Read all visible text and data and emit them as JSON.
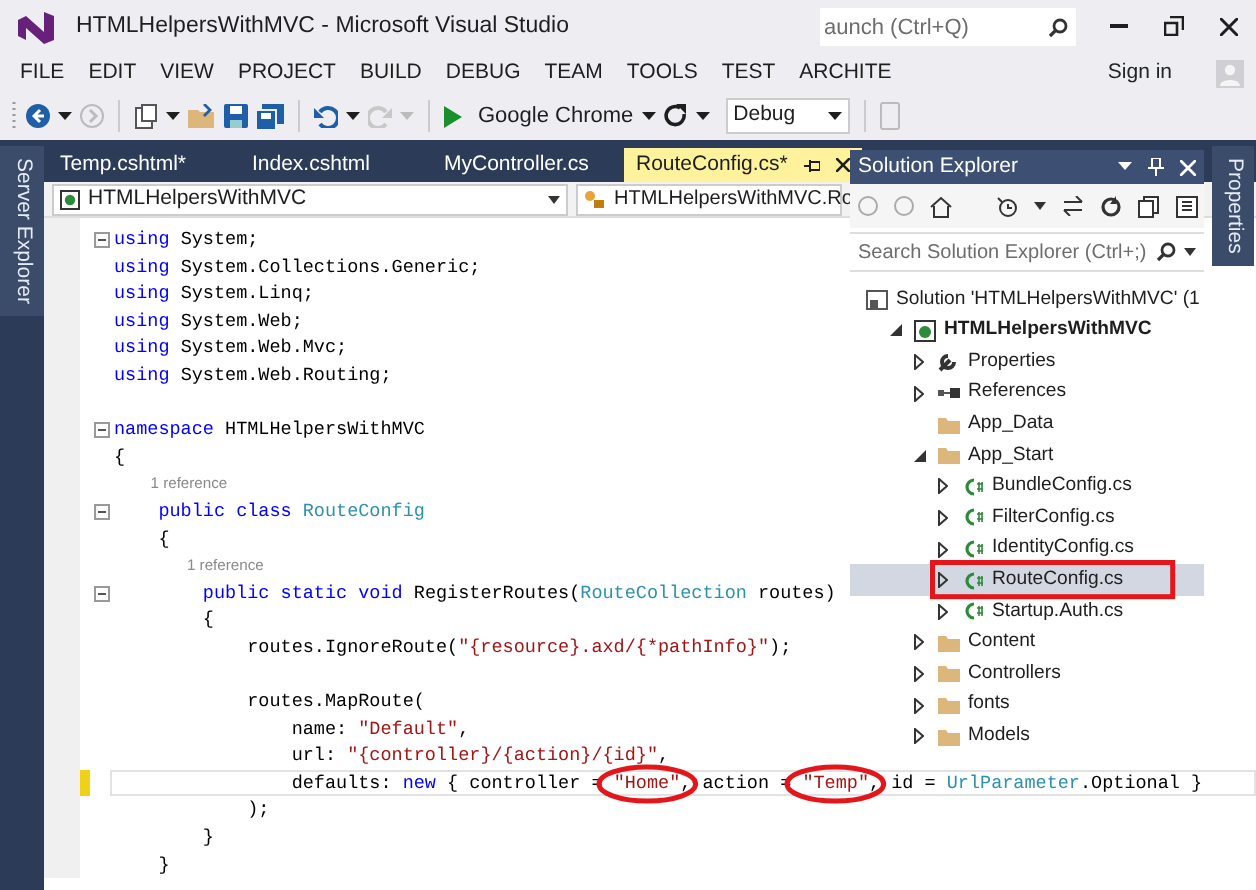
{
  "window": {
    "title": "HTMLHelpersWithMVC - Microsoft Visual Studio"
  },
  "quick_launch": {
    "placeholder": "aunch (Ctrl+Q)"
  },
  "menu": [
    "FILE",
    "EDIT",
    "VIEW",
    "PROJECT",
    "BUILD",
    "DEBUG",
    "TEAM",
    "TOOLS",
    "TEST",
    "ARCHITE"
  ],
  "account": {
    "label": "Sign in"
  },
  "toolbar": {
    "run_target": "Google Chrome",
    "configuration": "Debug"
  },
  "side_tabs": {
    "left": "Server Explorer",
    "right": "Properties"
  },
  "editor_tabs": [
    {
      "label": "Temp.cshtml*",
      "selected": false
    },
    {
      "label": "Index.cshtml",
      "selected": false
    },
    {
      "label": "MyController.cs",
      "selected": false
    },
    {
      "label": "RouteConfig.cs*",
      "selected": true
    }
  ],
  "nav_bar": {
    "project": "HTMLHelpersWithMVC",
    "type": "HTMLHelpersWithMVC.Ro"
  },
  "code_lines": [
    {
      "kind": "code",
      "fold": true,
      "modified": false,
      "current": false,
      "tokens": [
        {
          "kind": "kw",
          "text": "using"
        },
        {
          "kind": "plain",
          "text": " System;"
        }
      ]
    },
    {
      "kind": "code",
      "fold": false,
      "modified": false,
      "current": false,
      "tokens": [
        {
          "kind": "kw",
          "text": "using"
        },
        {
          "kind": "plain",
          "text": " System.Collections.Generic;"
        }
      ]
    },
    {
      "kind": "code",
      "fold": false,
      "modified": false,
      "current": false,
      "tokens": [
        {
          "kind": "kw",
          "text": "using"
        },
        {
          "kind": "plain",
          "text": " System.Linq;"
        }
      ]
    },
    {
      "kind": "code",
      "fold": false,
      "modified": false,
      "current": false,
      "tokens": [
        {
          "kind": "kw",
          "text": "using"
        },
        {
          "kind": "plain",
          "text": " System.Web;"
        }
      ]
    },
    {
      "kind": "code",
      "fold": false,
      "modified": false,
      "current": false,
      "tokens": [
        {
          "kind": "kw",
          "text": "using"
        },
        {
          "kind": "plain",
          "text": " System.Web.Mvc;"
        }
      ]
    },
    {
      "kind": "code",
      "fold": false,
      "modified": false,
      "current": false,
      "tokens": [
        {
          "kind": "kw",
          "text": "using"
        },
        {
          "kind": "plain",
          "text": " System.Web.Routing;"
        }
      ]
    },
    {
      "kind": "blank"
    },
    {
      "kind": "code",
      "fold": true,
      "modified": false,
      "current": false,
      "tokens": [
        {
          "kind": "kw",
          "text": "namespace"
        },
        {
          "kind": "plain",
          "text": " HTMLHelpersWithMVC"
        }
      ]
    },
    {
      "kind": "code",
      "fold": false,
      "modified": false,
      "current": false,
      "tokens": [
        {
          "kind": "plain",
          "text": "{"
        }
      ]
    },
    {
      "kind": "lens",
      "text": "1 reference"
    },
    {
      "kind": "code",
      "fold": true,
      "modified": false,
      "current": false,
      "tokens": [
        {
          "kind": "kw",
          "text": "    public "
        },
        {
          "kind": "kw",
          "text": "class "
        },
        {
          "kind": "type",
          "text": "RouteConfig"
        }
      ]
    },
    {
      "kind": "code",
      "fold": false,
      "modified": false,
      "current": false,
      "tokens": [
        {
          "kind": "plain",
          "text": "    {"
        }
      ]
    },
    {
      "kind": "lens",
      "text": "1 reference"
    },
    {
      "kind": "code",
      "fold": true,
      "modified": false,
      "current": false,
      "tokens": [
        {
          "kind": "kw",
          "text": "        public "
        },
        {
          "kind": "kw",
          "text": "static "
        },
        {
          "kind": "kw",
          "text": "void "
        },
        {
          "kind": "plain",
          "text": "RegisterRoutes("
        },
        {
          "kind": "type",
          "text": "RouteCollection"
        },
        {
          "kind": "plain",
          "text": " routes)"
        }
      ]
    },
    {
      "kind": "code",
      "fold": false,
      "modified": false,
      "current": false,
      "tokens": [
        {
          "kind": "plain",
          "text": "        {"
        }
      ]
    },
    {
      "kind": "code",
      "fold": false,
      "modified": false,
      "current": false,
      "tokens": [
        {
          "kind": "plain",
          "text": "            routes.IgnoreRoute("
        },
        {
          "kind": "str",
          "text": "\"{resource}.axd/{*pathInfo}\""
        },
        {
          "kind": "plain",
          "text": ");"
        }
      ]
    },
    {
      "kind": "blank"
    },
    {
      "kind": "code",
      "fold": false,
      "modified": false,
      "current": false,
      "tokens": [
        {
          "kind": "plain",
          "text": "            routes.MapRoute("
        }
      ]
    },
    {
      "kind": "code",
      "fold": false,
      "modified": false,
      "current": false,
      "tokens": [
        {
          "kind": "plain",
          "text": "                name: "
        },
        {
          "kind": "str",
          "text": "\"Default\""
        },
        {
          "kind": "plain",
          "text": ","
        }
      ]
    },
    {
      "kind": "code",
      "fold": false,
      "modified": false,
      "current": false,
      "tokens": [
        {
          "kind": "plain",
          "text": "                url: "
        },
        {
          "kind": "str",
          "text": "\"{controller}/{action}/{id}\""
        },
        {
          "kind": "plain",
          "text": ","
        }
      ]
    },
    {
      "kind": "code",
      "fold": false,
      "modified": true,
      "current": true,
      "tokens": [
        {
          "kind": "plain",
          "text": "                defaults: "
        },
        {
          "kind": "kw",
          "text": "new"
        },
        {
          "kind": "plain",
          "text": " { controller = "
        },
        {
          "kind": "str",
          "text": "\"Home\"",
          "circled": true
        },
        {
          "kind": "plain",
          "text": ", action = "
        },
        {
          "kind": "str",
          "text": "\"Temp\"",
          "circled": true
        },
        {
          "kind": "plain",
          "text": ", id = "
        },
        {
          "kind": "type",
          "text": "UrlParameter"
        },
        {
          "kind": "plain",
          "text": ".Optional }"
        }
      ]
    },
    {
      "kind": "code",
      "fold": false,
      "modified": false,
      "current": false,
      "tokens": [
        {
          "kind": "plain",
          "text": "            );"
        }
      ]
    },
    {
      "kind": "code",
      "fold": false,
      "modified": false,
      "current": false,
      "tokens": [
        {
          "kind": "plain",
          "text": "        }"
        }
      ]
    },
    {
      "kind": "code",
      "fold": false,
      "modified": false,
      "current": false,
      "tokens": [
        {
          "kind": "plain",
          "text": "    }"
        }
      ]
    }
  ],
  "solution_explorer": {
    "title": "Solution Explorer",
    "search": {
      "placeholder": "Search Solution Explorer (Ctrl+;)"
    },
    "tree": [
      {
        "kind": "solution",
        "label": "Solution 'HTMLHelpersWithMVC' (1",
        "selected": false,
        "annotated": false,
        "children": [
          {
            "kind": "project",
            "label": "HTMLHelpersWithMVC",
            "expanded": true,
            "selected": false,
            "annotated": false,
            "children": [
              {
                "kind": "properties",
                "label": "Properties",
                "expanded": false,
                "selected": false,
                "annotated": false
              },
              {
                "kind": "references",
                "label": "References",
                "expanded": false,
                "selected": false,
                "annotated": false
              },
              {
                "kind": "folder",
                "label": "App_Data",
                "selected": false,
                "annotated": false
              },
              {
                "kind": "folder",
                "label": "App_Start",
                "expanded": true,
                "selected": false,
                "annotated": false,
                "children": [
                  {
                    "kind": "cs",
                    "label": "BundleConfig.cs",
                    "expanded": false,
                    "selected": false,
                    "annotated": false
                  },
                  {
                    "kind": "cs",
                    "label": "FilterConfig.cs",
                    "expanded": false,
                    "selected": false,
                    "annotated": false
                  },
                  {
                    "kind": "cs",
                    "label": "IdentityConfig.cs",
                    "expanded": false,
                    "selected": false,
                    "annotated": false
                  },
                  {
                    "kind": "cs",
                    "label": "RouteConfig.cs",
                    "expanded": false,
                    "selected": true,
                    "annotated": true
                  },
                  {
                    "kind": "cs",
                    "label": "Startup.Auth.cs",
                    "expanded": false,
                    "selected": false,
                    "annotated": false
                  }
                ]
              },
              {
                "kind": "folder",
                "label": "Content",
                "expanded": false,
                "selected": false,
                "annotated": false
              },
              {
                "kind": "folder",
                "label": "Controllers",
                "expanded": false,
                "selected": false,
                "annotated": false
              },
              {
                "kind": "folder",
                "label": "fonts",
                "expanded": false,
                "selected": false,
                "annotated": false
              },
              {
                "kind": "folder",
                "label": "Models",
                "expanded": false,
                "selected": false,
                "annotated": false
              }
            ]
          }
        ]
      }
    ]
  }
}
